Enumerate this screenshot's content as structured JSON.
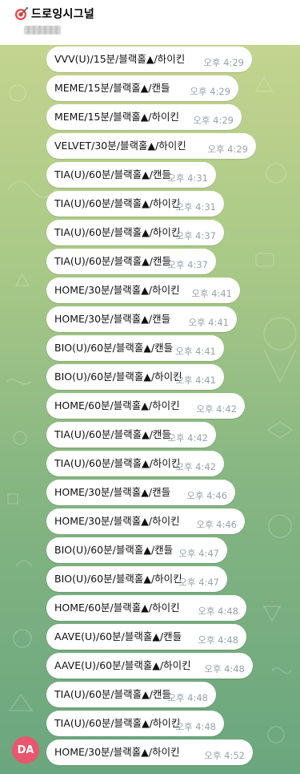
{
  "channel": {
    "name": "드로잉시그널",
    "subtitle_blurred": ""
  },
  "avatar": {
    "initials": "DA",
    "color": "#e8576e"
  },
  "messages": [
    {
      "text": "VVV(U)/15분/블랙홀▲/하이킨",
      "time": "오후 4:29"
    },
    {
      "text": "MEME/15분/블랙홀▲/캔들",
      "time": "오후 4:29"
    },
    {
      "text": "MEME/15분/블랙홀▲/하이킨",
      "time": "오후 4:29"
    },
    {
      "text": "VELVET/30분/블랙홀▲/하이킨",
      "time": "오후 4:29"
    },
    {
      "text": "TIA(U)/60분/블랙홀▲/캔들",
      "time": "오후 4:31"
    },
    {
      "text": "TIA(U)/60분/블랙홀▲/하이킨",
      "time": "오후 4:31"
    },
    {
      "text": "TIA(U)/60분/블랙홀▲/하이킨",
      "time": "오후 4:37"
    },
    {
      "text": "TIA(U)/60분/블랙홀▲/캔들",
      "time": "오후 4:37"
    },
    {
      "text": "HOME/30분/블랙홀▲/하이킨",
      "time": "오후 4:41"
    },
    {
      "text": "HOME/30분/블랙홀▲/캔들",
      "time": "오후 4:41"
    },
    {
      "text": "BIO(U)/60분/블랙홀▲/캔들",
      "time": "오후 4:41"
    },
    {
      "text": "BIO(U)/60분/블랙홀▲/하이킨",
      "time": "오후 4:41"
    },
    {
      "text": "HOME/60분/블랙홀▲/하이킨",
      "time": "오후 4:42"
    },
    {
      "text": "TIA(U)/60분/블랙홀▲/캔들",
      "time": "오후 4:42"
    },
    {
      "text": "TIA(U)/60분/블랙홀▲/하이킨",
      "time": "오후 4:42"
    },
    {
      "text": "HOME/30분/블랙홀▲/캔들",
      "time": "오후 4:46"
    },
    {
      "text": "HOME/30분/블랙홀▲/하이킨",
      "time": "오후 4:46"
    },
    {
      "text": "BIO(U)/60분/블랙홀▲/캔들",
      "time": "오후 4:47"
    },
    {
      "text": "BIO(U)/60분/블랙홀▲/하이킨",
      "time": "오후 4:47"
    },
    {
      "text": "HOME/60분/블랙홀▲/하이킨",
      "time": "오후 4:48"
    },
    {
      "text": "AAVE(U)/60분/블랙홀▲/캔들",
      "time": "오후 4:48"
    },
    {
      "text": "AAVE(U)/60분/블랙홀▲/하이킨",
      "time": "오후 4:48"
    },
    {
      "text": "TIA(U)/60분/블랙홀▲/캔들",
      "time": "오후 4:48"
    },
    {
      "text": "TIA(U)/60분/블랙홀▲/하이킨",
      "time": "오후 4:48"
    },
    {
      "text": "HOME/30분/블랙홀▲/하이킨",
      "time": "오후 4:52"
    }
  ]
}
